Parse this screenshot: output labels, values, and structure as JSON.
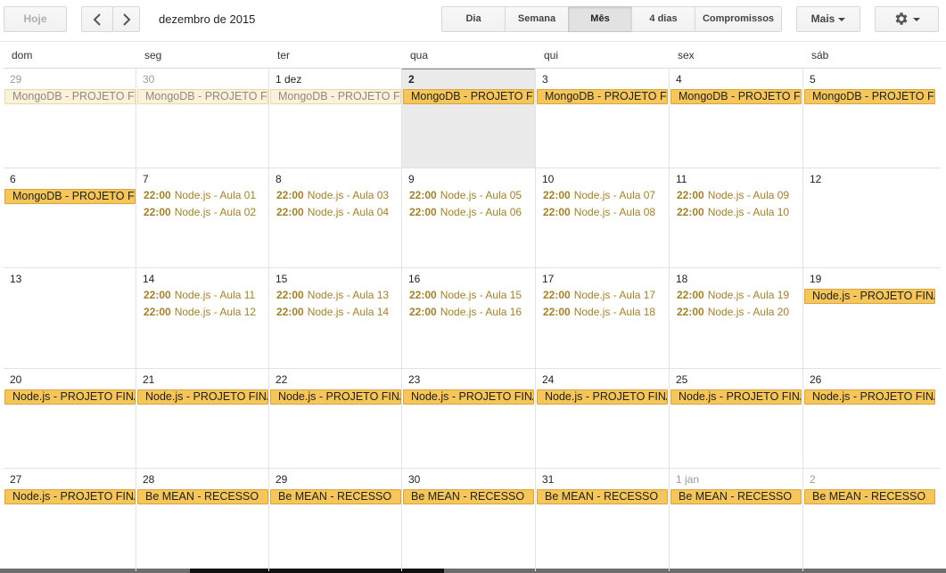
{
  "toolbar": {
    "today_label": "Hoje",
    "period_label": "dezembro de 2015",
    "views": [
      "Dia",
      "Semana",
      "Mês",
      "4 dias",
      "Compromissos"
    ],
    "active_view": "Mês",
    "more_label": "Mais"
  },
  "weekdays": [
    "dom",
    "seg",
    "ter",
    "qua",
    "qui",
    "sex",
    "sáb"
  ],
  "weeks": [
    {
      "days": [
        {
          "label": "29",
          "other": true
        },
        {
          "label": "30",
          "other": true
        },
        {
          "label": "1 dez"
        },
        {
          "label": "2",
          "today": true
        },
        {
          "label": "3"
        },
        {
          "label": "4"
        },
        {
          "label": "5"
        }
      ],
      "chips": [
        "MongoDB - PROJETO FINAL",
        "MongoDB - PROJETO FINAL",
        "MongoDB - PROJETO FINAL",
        "MongoDB - PROJETO FINAL",
        "MongoDB - PROJETO FINAL",
        "MongoDB - PROJETO FINAL",
        "MongoDB - PROJETO FINAL"
      ],
      "past_chips": [
        true,
        true,
        true,
        false,
        false,
        false,
        false
      ],
      "events": []
    },
    {
      "days": [
        {
          "label": "6"
        },
        {
          "label": "7"
        },
        {
          "label": "8"
        },
        {
          "label": "9"
        },
        {
          "label": "10"
        },
        {
          "label": "11"
        },
        {
          "label": "12"
        }
      ],
      "chips": [
        "MongoDB - PROJETO FINAL",
        null,
        null,
        null,
        null,
        null,
        null
      ],
      "events": [
        [],
        [
          [
            "22:00",
            "Node.js - Aula 01"
          ],
          [
            "22:00",
            "Node.js - Aula 02"
          ]
        ],
        [
          [
            "22:00",
            "Node.js - Aula 03"
          ],
          [
            "22:00",
            "Node.js - Aula 04"
          ]
        ],
        [
          [
            "22:00",
            "Node.js - Aula 05"
          ],
          [
            "22:00",
            "Node.js - Aula 06"
          ]
        ],
        [
          [
            "22:00",
            "Node.js - Aula 07"
          ],
          [
            "22:00",
            "Node.js - Aula 08"
          ]
        ],
        [
          [
            "22:00",
            "Node.js - Aula 09"
          ],
          [
            "22:00",
            "Node.js - Aula 10"
          ]
        ],
        []
      ]
    },
    {
      "days": [
        {
          "label": "13"
        },
        {
          "label": "14"
        },
        {
          "label": "15"
        },
        {
          "label": "16"
        },
        {
          "label": "17"
        },
        {
          "label": "18"
        },
        {
          "label": "19"
        }
      ],
      "chips": [
        null,
        null,
        null,
        null,
        null,
        null,
        "Node.js - PROJETO FINAL"
      ],
      "events": [
        [],
        [
          [
            "22:00",
            "Node.js - Aula 11"
          ],
          [
            "22:00",
            "Node.js - Aula 12"
          ]
        ],
        [
          [
            "22:00",
            "Node.js - Aula 13"
          ],
          [
            "22:00",
            "Node.js - Aula 14"
          ]
        ],
        [
          [
            "22:00",
            "Node.js - Aula 15"
          ],
          [
            "22:00",
            "Node.js - Aula 16"
          ]
        ],
        [
          [
            "22:00",
            "Node.js - Aula 17"
          ],
          [
            "22:00",
            "Node.js - Aula 18"
          ]
        ],
        [
          [
            "22:00",
            "Node.js - Aula 19"
          ],
          [
            "22:00",
            "Node.js - Aula 20"
          ]
        ],
        []
      ]
    },
    {
      "days": [
        {
          "label": "20"
        },
        {
          "label": "21"
        },
        {
          "label": "22"
        },
        {
          "label": "23"
        },
        {
          "label": "24"
        },
        {
          "label": "25"
        },
        {
          "label": "26"
        }
      ],
      "chips": [
        "Node.js - PROJETO FINAL",
        "Node.js - PROJETO FINAL",
        "Node.js - PROJETO FINAL",
        "Node.js - PROJETO FINAL",
        "Node.js - PROJETO FINAL",
        "Node.js - PROJETO FINAL",
        "Node.js - PROJETO FINAL"
      ],
      "events": []
    },
    {
      "days": [
        {
          "label": "27"
        },
        {
          "label": "28"
        },
        {
          "label": "29"
        },
        {
          "label": "30"
        },
        {
          "label": "31"
        },
        {
          "label": "1 jan",
          "other": true
        },
        {
          "label": "2",
          "other": true
        }
      ],
      "chips": [
        "Node.js - PROJETO FINAL",
        "Be MEAN - RECESSO",
        "Be MEAN - RECESSO",
        "Be MEAN - RECESSO",
        "Be MEAN - RECESSO",
        "Be MEAN - RECESSO",
        "Be MEAN - RECESSO"
      ],
      "events": []
    }
  ]
}
